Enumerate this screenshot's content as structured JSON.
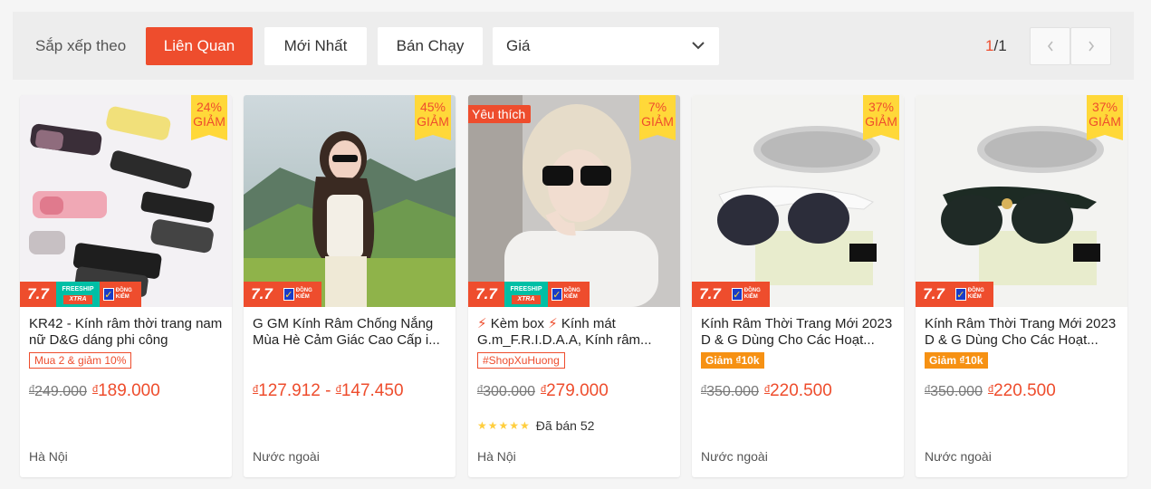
{
  "sort": {
    "label": "Sắp xếp theo",
    "buttons": [
      "Liên Quan",
      "Mới Nhất",
      "Bán Chạy"
    ],
    "active": "Liên Quan",
    "price_select": "Giá",
    "page_current": "1",
    "page_total": "/1"
  },
  "colors": {
    "accent": "#ee4d2d",
    "badge": "#ffd839"
  },
  "products": [
    {
      "discount_pct": "24%",
      "discount_word": "GIẢM",
      "promo": "7.7",
      "freeship": true,
      "freeship_label": "FREESHIP",
      "freeship_sub": "XTRA",
      "dk_label": "ĐỒNG KIỂM",
      "title": "KR42 - Kính râm thời trang nam nữ D&G dáng phi công",
      "tag": "Mua 2 & giảm 10%",
      "tag_style": "outline",
      "old_price": "249.000",
      "price": "189.000",
      "location": "Hà Nội"
    },
    {
      "discount_pct": "45%",
      "discount_word": "GIẢM",
      "promo": "7.7",
      "freeship": false,
      "dk_label": "ĐỒNG KIỂM",
      "title": "G GM Kính Râm Chống Nắng Mùa Hè Cảm Giác Cao Cấp i...",
      "price_range_low": "127.912",
      "price_range_sep": "-",
      "price_range_high": "147.450",
      "location": "Nước ngoài"
    },
    {
      "favorite": "Yêu thích",
      "discount_pct": "7%",
      "discount_word": "GIẢM",
      "promo": "7.7",
      "freeship": true,
      "freeship_label": "FREESHIP",
      "freeship_sub": "XTRA",
      "dk_label": "ĐỒNG KIỂM",
      "title_parts": [
        "Kèm box",
        "Kính mát G.m_F.R.I.D.A.A, Kính râm..."
      ],
      "tag": "#ShopXuHuong",
      "tag_style": "outline",
      "old_price": "300.000",
      "price": "279.000",
      "rating": 5,
      "sold": "Đã bán 52",
      "location": "Hà Nội"
    },
    {
      "discount_pct": "37%",
      "discount_word": "GIẢM",
      "promo": "7.7",
      "freeship": false,
      "dk_label": "ĐỒNG KIỂM",
      "title": "Kính Râm Thời Trang Mới 2023 D & G Dùng Cho Các Hoạt...",
      "tag": "Giảm ₫10k",
      "tag_style": "filled",
      "old_price": "350.000",
      "price": "220.500",
      "location": "Nước ngoài"
    },
    {
      "discount_pct": "37%",
      "discount_word": "GIẢM",
      "promo": "7.7",
      "freeship": false,
      "dk_label": "ĐỒNG KIỂM",
      "title": "Kính Râm Thời Trang Mới 2023 D & G Dùng Cho Các Hoạt...",
      "tag": "Giảm ₫10k",
      "tag_style": "filled",
      "old_price": "350.000",
      "price": "220.500",
      "location": "Nước ngoài"
    }
  ],
  "currency_symbol": "đ"
}
